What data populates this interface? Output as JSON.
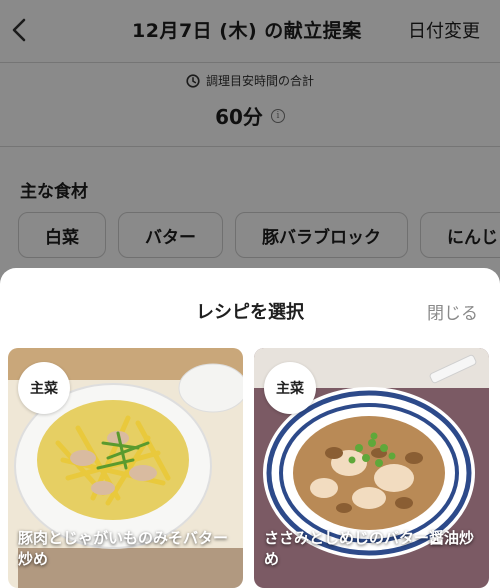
{
  "header": {
    "title": "12月7日 (木) の献立提案",
    "date_change": "日付変更"
  },
  "cook_time": {
    "label": "調理目安時間の合計",
    "value": "60分",
    "info": "i"
  },
  "ingredients": {
    "title": "主な食材",
    "items": [
      "白菜",
      "バター",
      "豚バラブロック",
      "にんじ"
    ]
  },
  "sheet": {
    "title": "レシピを選択",
    "close": "閉じる"
  },
  "recipes": [
    {
      "badge": "主菜",
      "name": "豚肉とじゃがいものみそバター炒め"
    },
    {
      "badge": "主菜",
      "name": "ささみとしめじのバター醤油炒め"
    }
  ]
}
